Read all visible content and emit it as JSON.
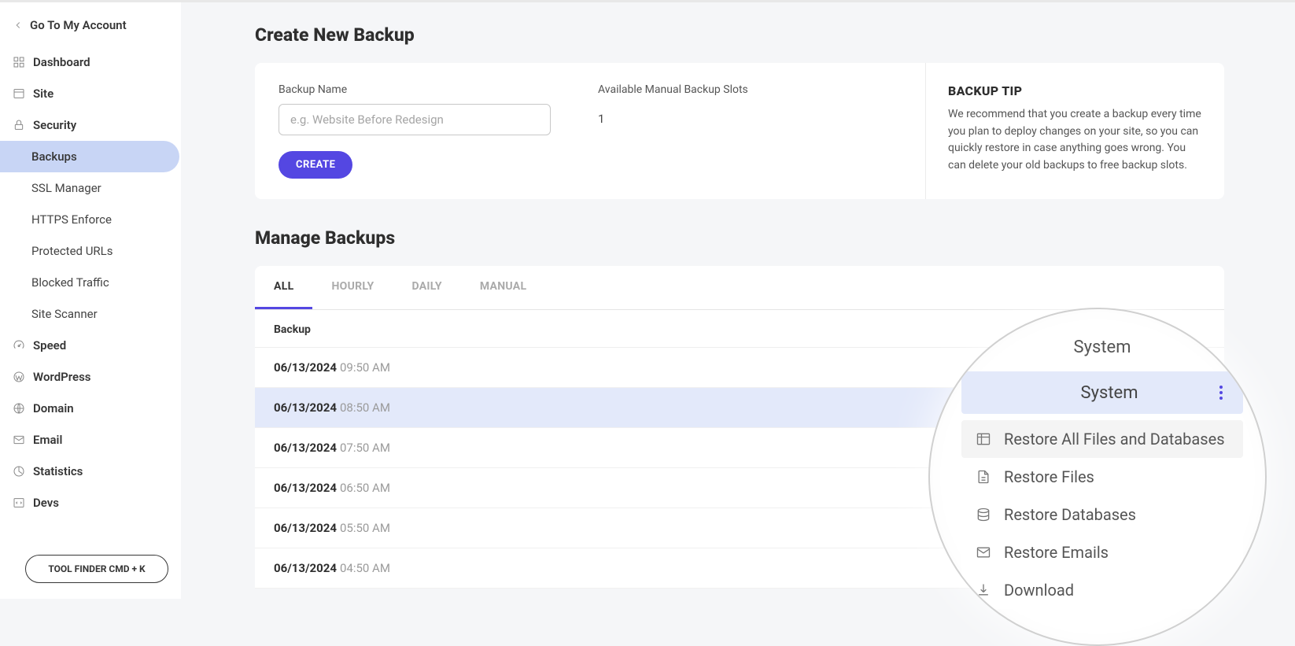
{
  "back_link": "Go To My Account",
  "sidebar": {
    "items": [
      {
        "label": "Dashboard"
      },
      {
        "label": "Site"
      },
      {
        "label": "Security"
      },
      {
        "label": "Speed"
      },
      {
        "label": "WordPress"
      },
      {
        "label": "Domain"
      },
      {
        "label": "Email"
      },
      {
        "label": "Statistics"
      },
      {
        "label": "Devs"
      }
    ],
    "security_subs": [
      {
        "label": "Backups"
      },
      {
        "label": "SSL Manager"
      },
      {
        "label": "HTTPS Enforce"
      },
      {
        "label": "Protected URLs"
      },
      {
        "label": "Blocked Traffic"
      },
      {
        "label": "Site Scanner"
      }
    ],
    "tool_finder": "TOOL FINDER CMD + K"
  },
  "create_section": {
    "title": "Create New Backup",
    "name_label": "Backup Name",
    "name_placeholder": "e.g. Website Before Redesign",
    "slots_label": "Available Manual Backup Slots",
    "slots_value": "1",
    "create_btn": "CREATE",
    "tip_heading": "BACKUP TIP",
    "tip_text": "We recommend that you create a backup every time you plan to deploy changes on your site, so you can quickly restore in case anything goes wrong. You can delete your old backups to free backup slots."
  },
  "manage_section": {
    "title": "Manage Backups",
    "tabs": [
      "ALL",
      "HOURLY",
      "DAILY",
      "MANUAL"
    ],
    "th_backup": "Backup",
    "rows": [
      {
        "date": "06/13/2024",
        "time": "09:50 AM"
      },
      {
        "date": "06/13/2024",
        "time": "08:50 AM"
      },
      {
        "date": "06/13/2024",
        "time": "07:50 AM"
      },
      {
        "date": "06/13/2024",
        "time": "06:50 AM"
      },
      {
        "date": "06/13/2024",
        "time": "05:50 AM"
      },
      {
        "date": "06/13/2024",
        "time": "04:50 AM"
      }
    ]
  },
  "zoom": {
    "system_label1": "System",
    "system_label2": "System",
    "menu": [
      "Restore All Files and Databases",
      "Restore Files",
      "Restore Databases",
      "Restore Emails",
      "Download"
    ]
  }
}
